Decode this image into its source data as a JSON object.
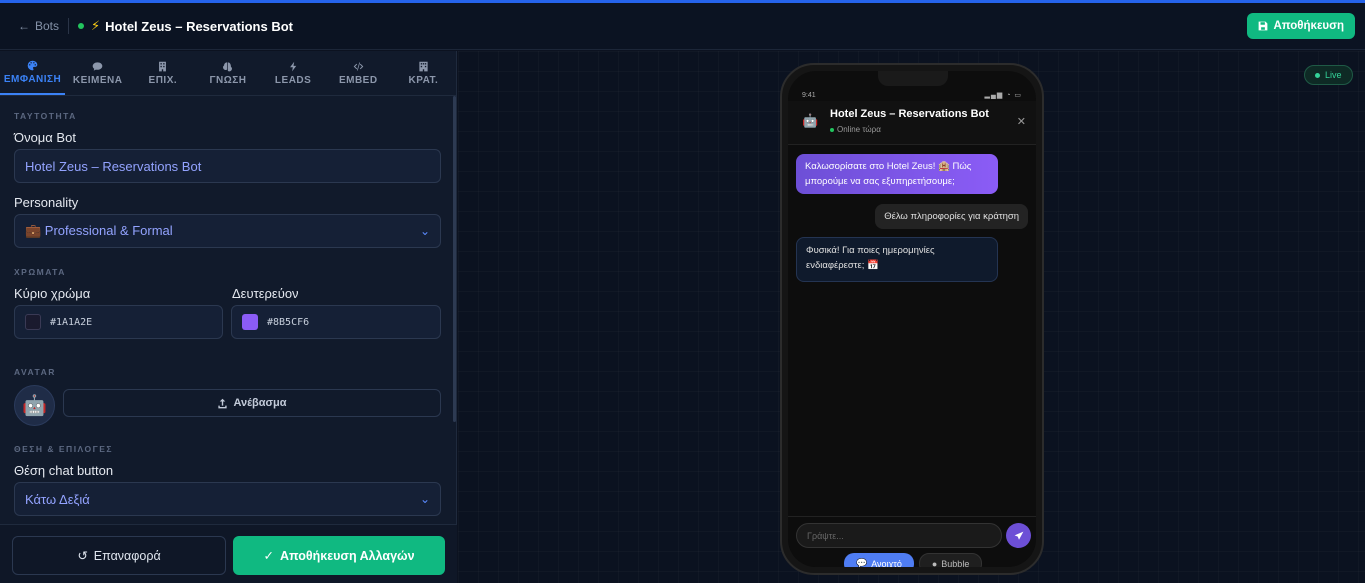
{
  "header": {
    "back_label": "Bots",
    "bot_title": "Hotel Zeus – Reservations Bot",
    "save_label": "Αποθήκευση"
  },
  "tabs": [
    {
      "label": "ΕΜΦΑΝΙΣΗ",
      "icon": "palette-icon",
      "active": true
    },
    {
      "label": "ΚΕΙΜΕΝΑ",
      "icon": "message-icon",
      "active": false
    },
    {
      "label": "ΕΠΙΧ.",
      "icon": "building-icon",
      "active": false
    },
    {
      "label": "ΓΝΩΣΗ",
      "icon": "brain-icon",
      "active": false
    },
    {
      "label": "LEADS",
      "icon": "bolt-icon",
      "active": false
    },
    {
      "label": "EMBED",
      "icon": "code-icon",
      "active": false
    },
    {
      "label": "ΚΡΑΤ.",
      "icon": "hotel-icon",
      "active": false
    }
  ],
  "identity": {
    "section": "ΤΑΥΤΟΤΗΤΑ",
    "name_label": "Όνομα Bot",
    "name_value": "Hotel Zeus – Reservations Bot",
    "personality_label": "Personality",
    "personality_value": "💼 Professional & Formal"
  },
  "colors": {
    "section": "ΧΡΩΜΑΤΑ",
    "primary_label": "Κύριο χρώμα",
    "primary_hex": "#1A1A2E",
    "secondary_label": "Δευτερεύον",
    "secondary_hex": "#8B5CF6"
  },
  "avatar": {
    "section": "AVATAR",
    "emoji": "🤖",
    "upload_label": "Ανέβασμα"
  },
  "position": {
    "section": "ΘΕΣΗ & ΕΠΙΛΟΓΕΣ",
    "label": "Θέση chat button",
    "value": "Κάτω Δεξιά"
  },
  "footer": {
    "reset_label": "Επαναφορά",
    "apply_label": "Αποθήκευση Αλλαγών"
  },
  "preview": {
    "live_label": "Live",
    "time": "9:41",
    "bot_name": "Hotel Zeus – Reservations Bot",
    "bot_status": "Online τώρα",
    "messages": [
      {
        "from": "bot",
        "text": "Καλωσορίσατε στο Hotel Zeus! 🏨 Πώς μπορούμε να σας εξυπηρετήσουμε;"
      },
      {
        "from": "user",
        "text": "Θέλω πληροφορίες για κράτηση"
      },
      {
        "from": "bot",
        "text": "Φυσικά! Για ποιες ημερομηνίες ενδιαφέρεστε; 📅"
      }
    ],
    "input_placeholder": "Γράψτε...",
    "mode_open": "Ανοιχτό",
    "mode_bubble": "Bubble"
  },
  "accent_colors": {
    "primary": "#2563eb",
    "success": "#10b981",
    "purple": "#8b5cf6"
  }
}
